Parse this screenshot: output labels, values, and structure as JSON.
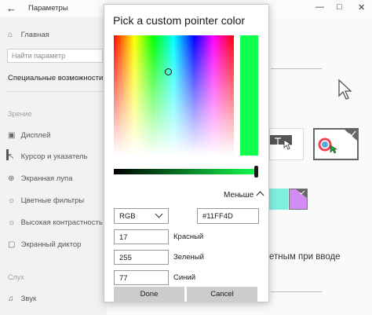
{
  "window": {
    "title": "Параметры",
    "back_icon": "back-arrow-icon",
    "controls": [
      "minimize-icon",
      "maximize-icon",
      "close-icon"
    ]
  },
  "sidebar": {
    "home_label": "Главная",
    "search_placeholder": "Найти параметр",
    "category_heading": "Специальные возможности",
    "section_vision": "Зрение",
    "items": [
      {
        "label": "Дисплей",
        "icon": "display-icon"
      },
      {
        "label": "Курсор и указатель",
        "icon": "cursor-icon"
      },
      {
        "label": "Экранная лупа",
        "icon": "magnifier-icon"
      },
      {
        "label": "Цветные фильтры",
        "icon": "color-filter-icon"
      },
      {
        "label": "Высокая контрастность",
        "icon": "contrast-icon"
      },
      {
        "label": "Экранный диктор",
        "icon": "narrator-icon"
      }
    ],
    "section_hearing": "Слух",
    "hearing_items": [
      {
        "label": "Звук",
        "icon": "speaker-icon"
      }
    ]
  },
  "main": {
    "partial_text": "етным при вводе"
  },
  "dialog": {
    "title": "Pick a custom pointer color",
    "less_label": "Меньше",
    "color_model": "RGB",
    "hex_value": "#11FF4D",
    "red_value": "17",
    "red_label": "Красный",
    "green_value": "255",
    "green_label": "Зеленый",
    "blue_value": "77",
    "blue_label": "Синий",
    "done_label": "Done",
    "cancel_label": "Cancel",
    "selected_color": "#11ff4d"
  }
}
